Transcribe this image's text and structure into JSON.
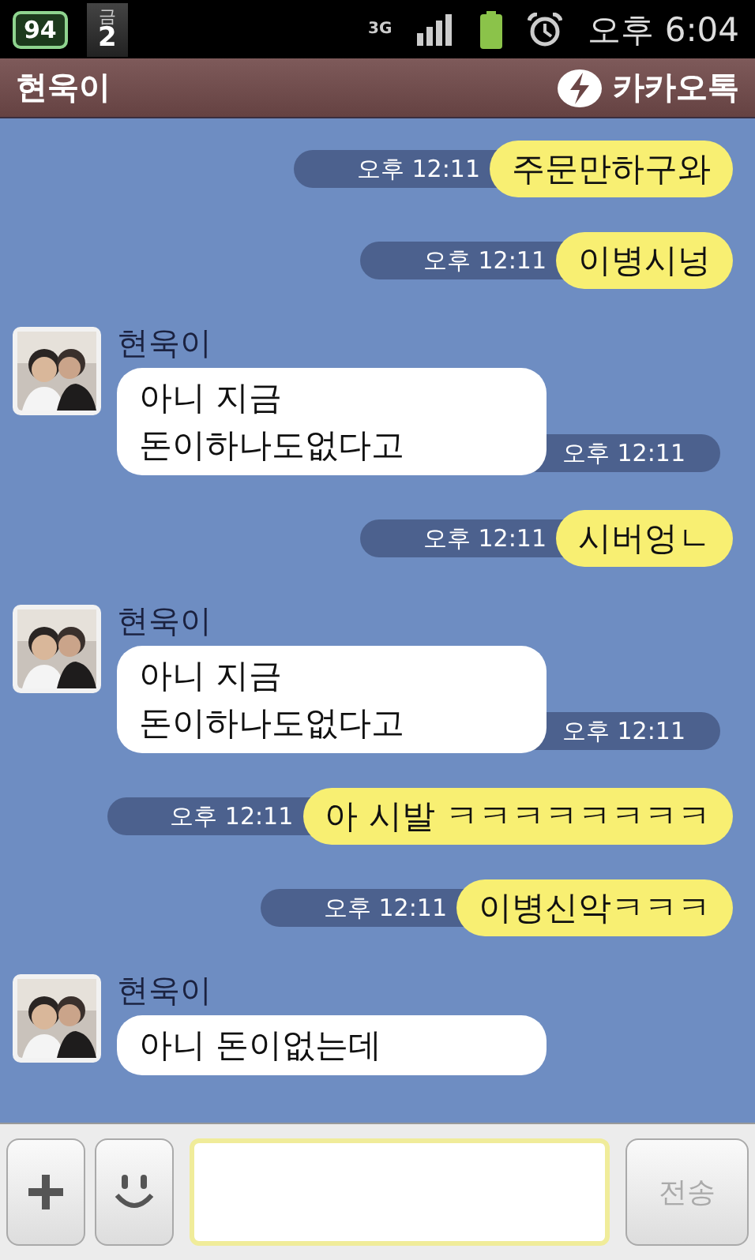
{
  "status_bar": {
    "battery_badge": "94",
    "calendar_day": "금",
    "calendar_date": "2",
    "network": "3G",
    "time": "오후 6:04"
  },
  "header": {
    "title": "현욱이",
    "app_name": "카카오톡"
  },
  "messages": [
    {
      "kind": "sent",
      "text": "주문만하구와",
      "time": "오후 12:11"
    },
    {
      "kind": "sent",
      "text": "이병시넝",
      "time": "오후 12:11"
    },
    {
      "kind": "received",
      "sender": "현욱이",
      "text": "아니 지금\n돈이하나도없다고",
      "time": "오후 12:11"
    },
    {
      "kind": "sent",
      "text": "시버엉ㄴ",
      "time": "오후 12:11"
    },
    {
      "kind": "received",
      "sender": "현욱이",
      "text": "아니 지금\n돈이하나도없다고",
      "time": "오후 12:11"
    },
    {
      "kind": "sent",
      "text": "아 시발 ㅋㅋㅋㅋㅋㅋㅋㅋ",
      "time": "오후 12:11"
    },
    {
      "kind": "sent",
      "text": "이병신악ㅋㅋㅋ",
      "time": "오후 12:11"
    },
    {
      "kind": "received",
      "sender": "현욱이",
      "text": "아니 돈이없는데"
    }
  ],
  "composer": {
    "send_label": "전송",
    "send_disabled": true
  }
}
